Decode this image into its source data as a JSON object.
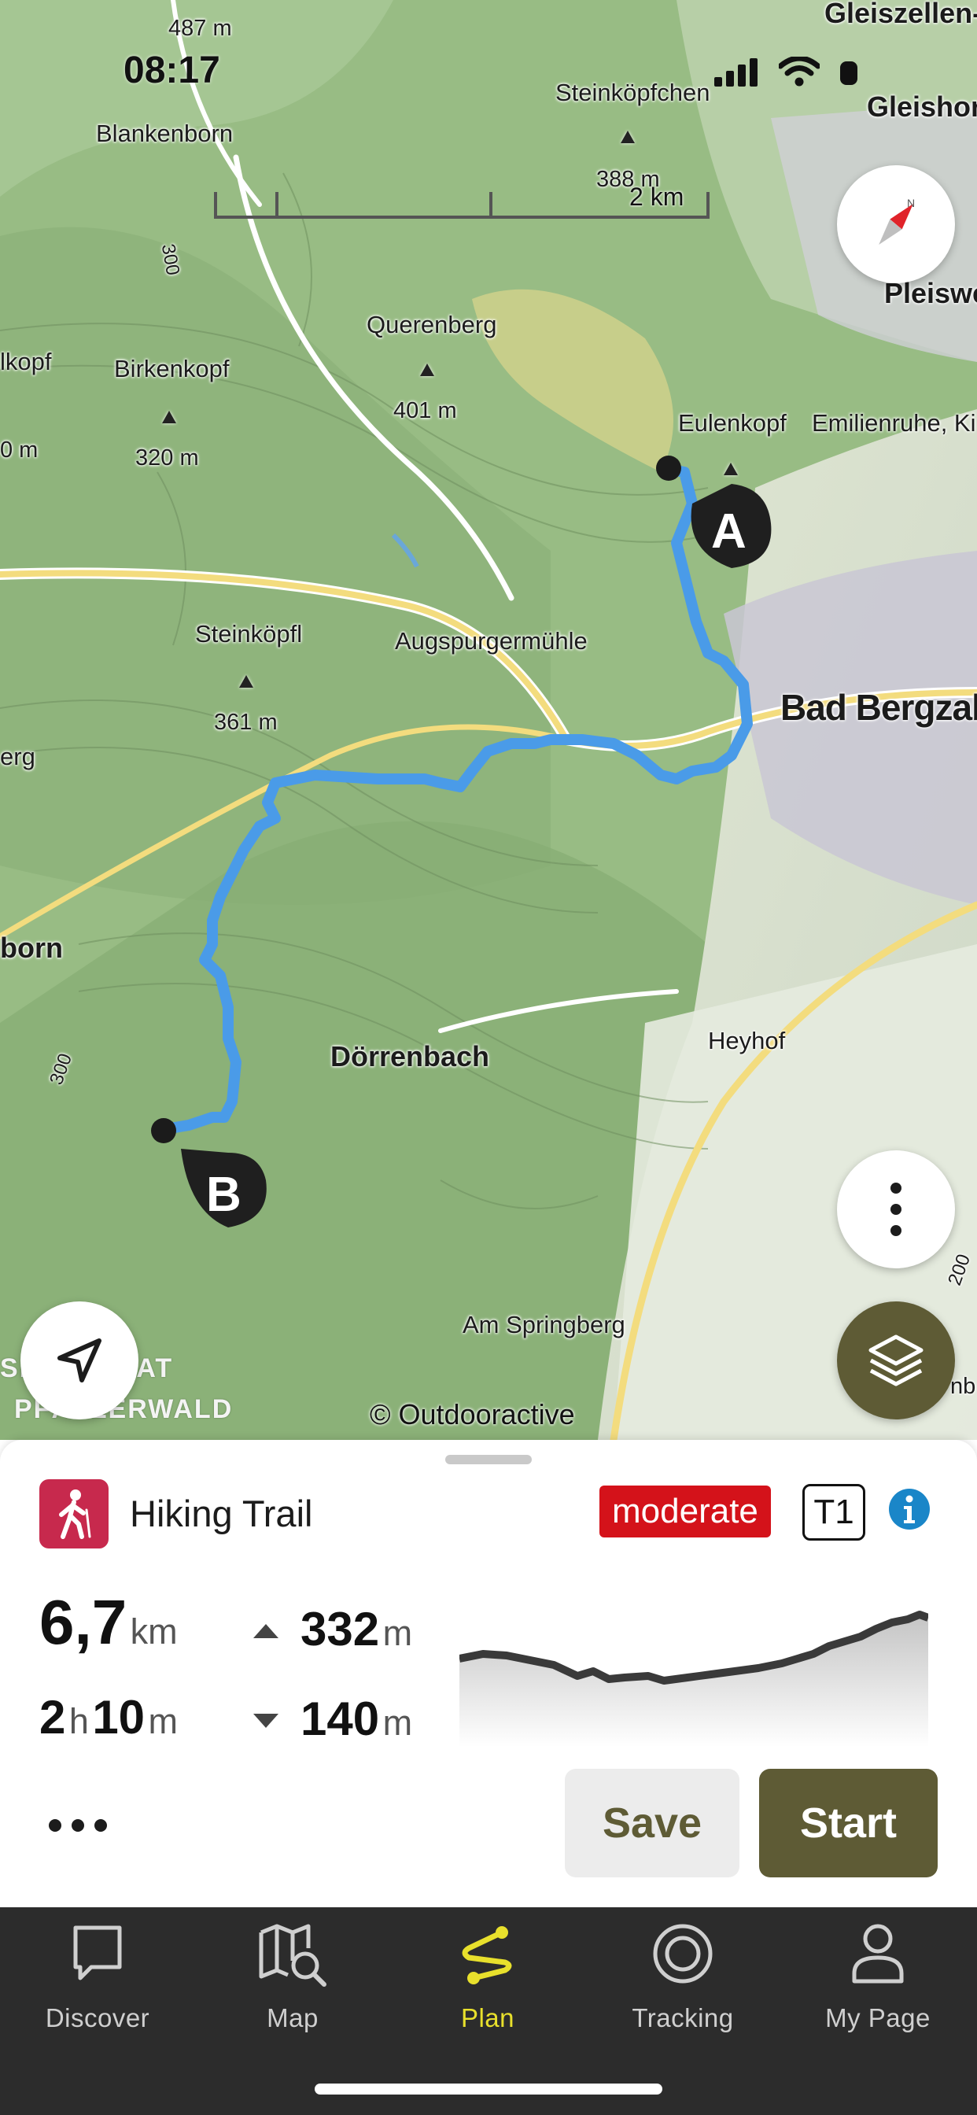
{
  "status_bar": {
    "time": "08:17"
  },
  "map": {
    "scale_label": "2 km",
    "attribution": "© Outdooractive",
    "labels": {
      "gleiszellen": "Gleiszellen-G",
      "gleishorb": "Gleishorb",
      "pleiswe": "Pleiswe",
      "blankenborn": "Blankenborn",
      "steinkoepfchen": "Steinköpfchen",
      "steinkoepfchen_elev": "388 m",
      "elev_487": "487 m",
      "querenberg": "Querenberg",
      "querenberg_elev": "401 m",
      "birkenkopf": "Birkenkopf",
      "birkenkopf_elev": "320 m",
      "lkopf": "lkopf",
      "m_left": "0 m",
      "eulenkopf": "Eulenkopf",
      "emilienruhe": "Emilienruhe, Ki",
      "steinkoepfl": "Steinköpfl",
      "steinkoepfl_elev": "361 m",
      "augspurgermuehle": "Augspurgermühle",
      "bad_bergzabern": "Bad Bergzab",
      "erg": "erg",
      "born": "born",
      "doerrenbach": "Dörrenbach",
      "heyhof": "Heyhof",
      "am_springberg": "Am Springberg",
      "reservat": "SRESERVAT",
      "pfaelzerwald": "PFÄLZERWALD",
      "contour_300_a": "300",
      "contour_300_b": "300",
      "contour_200": "200",
      "nb": "nb"
    },
    "markers": {
      "start": "A",
      "end": "B"
    },
    "route_color": "#4a9be8"
  },
  "route": {
    "activity": "Hiking Trail",
    "difficulty": "moderate",
    "difficulty_color": "#d4121a",
    "sac_scale": "T1",
    "distance_value": "6,7",
    "distance_unit": "km",
    "duration_hours": "2",
    "duration_hours_unit": "h",
    "duration_minutes": "10",
    "duration_minutes_unit": "m",
    "ascent_value": "332",
    "ascent_unit": "m",
    "descent_value": "140",
    "descent_unit": "m",
    "save_label": "Save",
    "start_label": "Start",
    "accent_color": "#5e5b35"
  },
  "tabs": [
    {
      "label": "Discover",
      "icon": "speech-bubble-icon"
    },
    {
      "label": "Map",
      "icon": "map-search-icon"
    },
    {
      "label": "Plan",
      "icon": "route-plan-icon",
      "active": true
    },
    {
      "label": "Tracking",
      "icon": "tracking-target-icon"
    },
    {
      "label": "My Page",
      "icon": "person-icon"
    }
  ]
}
